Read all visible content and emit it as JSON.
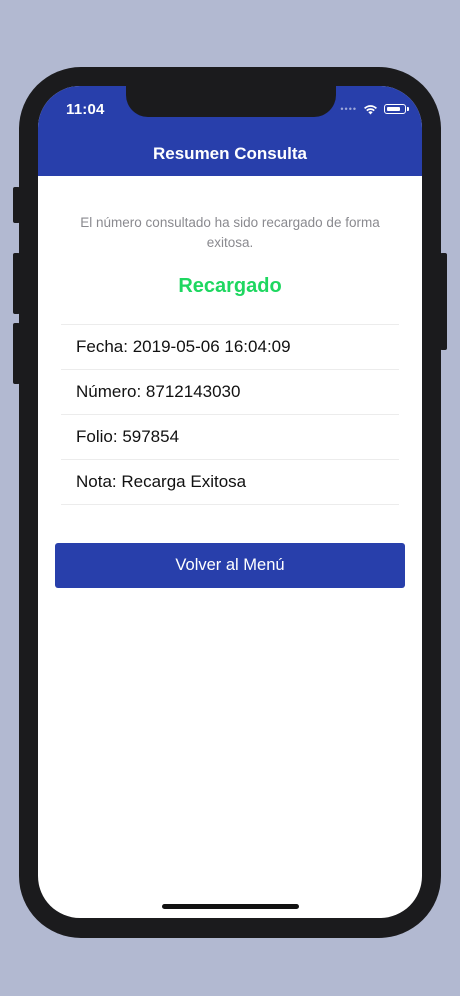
{
  "status_bar": {
    "time": "11:04",
    "signal_icon": "signal-icon",
    "wifi_icon": "wifi-icon",
    "battery_icon": "battery-icon"
  },
  "navbar": {
    "title": "Resumen Consulta"
  },
  "result": {
    "message": "El número consultado ha sido recargado de forma exitosa.",
    "status": "Recargado",
    "status_color": "#1ed760"
  },
  "details": [
    {
      "label": "Fecha:",
      "value": "2019-05-06 16:04:09"
    },
    {
      "label": "Número:",
      "value": "8712143030"
    },
    {
      "label": "Folio:",
      "value": "597854"
    },
    {
      "label": "Nota:",
      "value": "Recarga Exitosa"
    }
  ],
  "actions": {
    "back_to_menu_label": "Volver al Menú"
  },
  "colors": {
    "brand": "#283fab",
    "background": "#b2b9d1",
    "success": "#1ed760"
  }
}
